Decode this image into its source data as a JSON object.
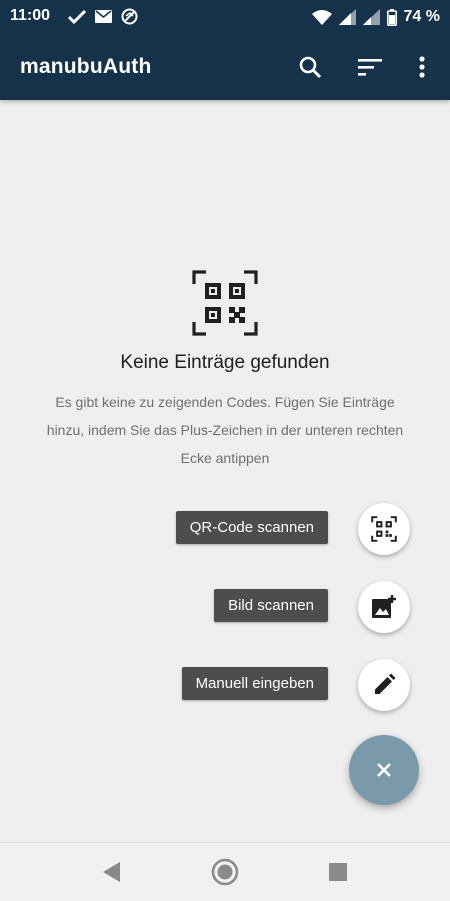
{
  "status_bar": {
    "time": "11:00",
    "battery": "74 %",
    "left_icons": [
      "check-icon",
      "mail-icon",
      "sync-off-icon"
    ],
    "right_icons": [
      "wifi-icon",
      "signal-icon",
      "signal-icon",
      "battery-icon"
    ]
  },
  "app_bar": {
    "title": "manubuAuth",
    "actions": [
      "search-icon",
      "sort-icon",
      "more-vert-icon"
    ],
    "background": "#16324b"
  },
  "empty_state": {
    "icon": "qr-code-scan-icon",
    "title": "Keine Einträge gefunden",
    "description": "Es gibt keine zu zeigenden Codes. Fügen Sie Einträge hinzu, indem Sie das Plus-Zeichen in der unteren rechten Ecke antippen"
  },
  "fab_menu": {
    "items": [
      {
        "label": "QR-Code scannen",
        "icon": "qr-code-scan-icon"
      },
      {
        "label": "Bild scannen",
        "icon": "add-photo-icon"
      },
      {
        "label": "Manuell eingeben",
        "icon": "pencil-icon"
      }
    ],
    "main_fab_icon": "close-icon",
    "main_fab_color": "#7a9aab"
  },
  "nav_bar": {
    "buttons": [
      "back-icon",
      "home-icon",
      "recents-icon"
    ]
  }
}
